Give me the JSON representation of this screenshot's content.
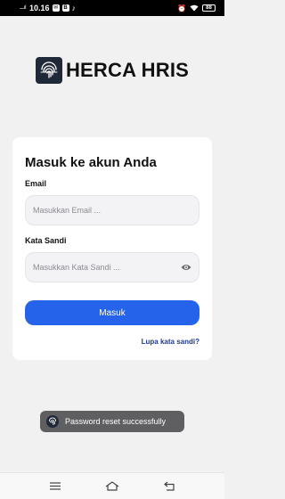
{
  "status_bar": {
    "dots": "....ıl",
    "time": "10.16",
    "icons": [
      "message-icon",
      "b-icon",
      "tiktok-icon",
      "alarm-icon",
      "wifi-icon",
      "battery-icon"
    ],
    "battery": "88"
  },
  "app": {
    "title": "HERCA HRIS",
    "logo_icon": "fingerprint-icon",
    "logo_bg": "#1f2937"
  },
  "login": {
    "heading": "Masuk ke akun Anda",
    "email_label": "Email",
    "email_placeholder": "Masukkan Email ...",
    "email_value": "",
    "password_label": "Kata Sandi",
    "password_placeholder": "Masukkan Kata Sandi ...",
    "password_value": "",
    "toggle_icon": "eye-icon",
    "submit_label": "Masuk",
    "submit_color": "#2563eb",
    "forgot_label": "Lupa kata sandi?",
    "forgot_color": "#1e3a8a"
  },
  "toast": {
    "message": "Password reset successfully",
    "icon": "fingerprint-icon"
  },
  "nav": {
    "buttons": [
      "menu-icon",
      "home-icon",
      "back-icon"
    ]
  }
}
